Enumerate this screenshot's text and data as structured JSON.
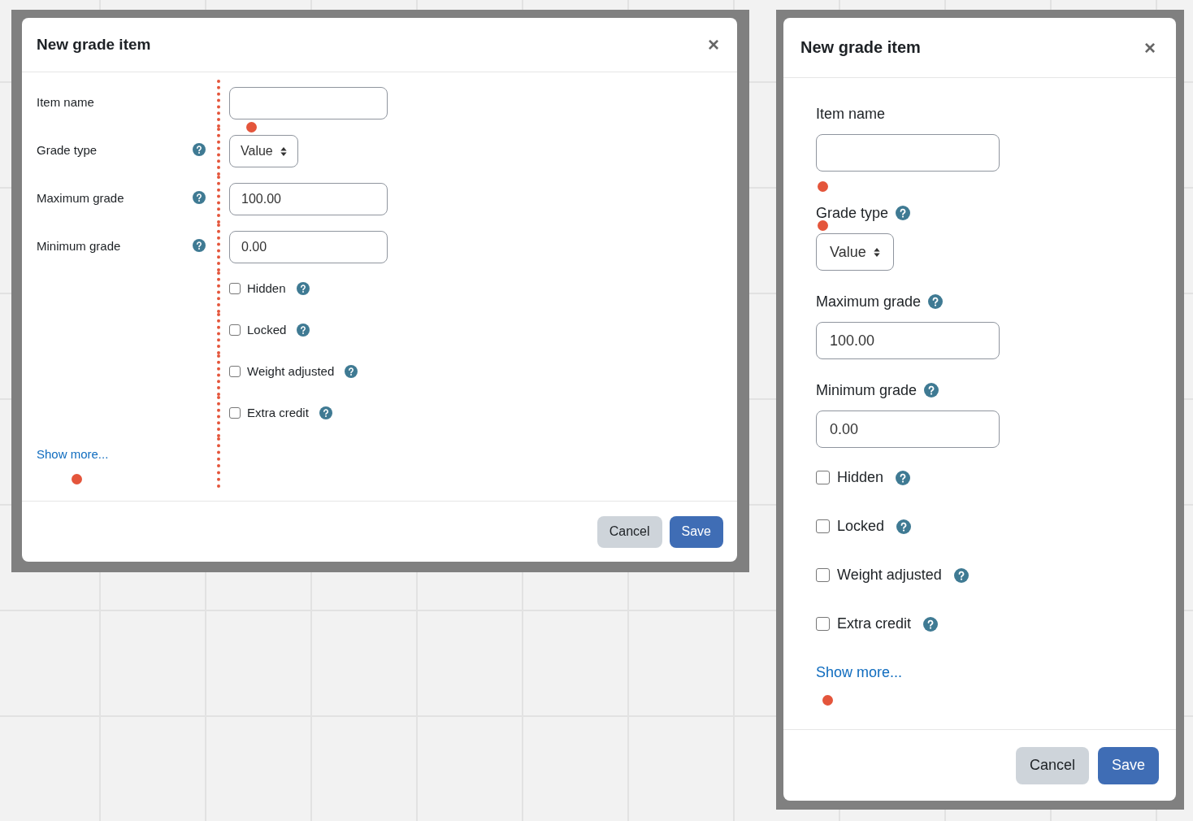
{
  "dialogs": [
    {
      "kind": "desktop",
      "title": "New grade item",
      "close": "×",
      "fields": [
        {
          "kind": "text",
          "label": "Item name",
          "help": false,
          "marker": true
        },
        {
          "kind": "select",
          "label": "Grade type",
          "help": true,
          "value": "Value"
        },
        {
          "kind": "text",
          "label": "Maximum grade",
          "help": true,
          "value": "100.00"
        },
        {
          "kind": "text",
          "label": "Minimum grade",
          "help": true,
          "value": "0.00"
        },
        {
          "kind": "checkbox",
          "label": "Hidden",
          "help": true,
          "checked": false
        },
        {
          "kind": "checkbox",
          "label": "Locked",
          "help": true,
          "checked": false
        },
        {
          "kind": "checkbox",
          "label": "Weight adjusted",
          "help": true,
          "checked": false
        },
        {
          "kind": "checkbox",
          "label": "Extra credit",
          "help": true,
          "checked": false
        }
      ],
      "show_more": {
        "label": "Show more...",
        "marker": true
      },
      "buttons": [
        {
          "label": "Cancel",
          "kind": "secondary"
        },
        {
          "label": "Save",
          "kind": "primary"
        }
      ]
    },
    {
      "kind": "mobile",
      "title": "New grade item",
      "close": "×",
      "fields": [
        {
          "kind": "text",
          "label": "Item name",
          "help": false,
          "marker": true
        },
        {
          "kind": "select",
          "label": "Grade type",
          "help": true,
          "value": "Value",
          "label_marker": true
        },
        {
          "kind": "text",
          "label": "Maximum grade",
          "help": true,
          "value": "100.00"
        },
        {
          "kind": "text",
          "label": "Minimum grade",
          "help": true,
          "value": "0.00"
        },
        {
          "kind": "checkbox",
          "label": "Hidden",
          "help": true,
          "checked": false
        },
        {
          "kind": "checkbox",
          "label": "Locked",
          "help": true,
          "checked": false
        },
        {
          "kind": "checkbox",
          "label": "Weight adjusted",
          "help": true,
          "checked": false
        },
        {
          "kind": "checkbox",
          "label": "Extra credit",
          "help": true,
          "checked": false
        }
      ],
      "show_more": {
        "label": "Show more...",
        "marker": true
      },
      "buttons": [
        {
          "label": "Cancel",
          "kind": "secondary"
        },
        {
          "label": "Save",
          "kind": "primary"
        }
      ]
    }
  ]
}
